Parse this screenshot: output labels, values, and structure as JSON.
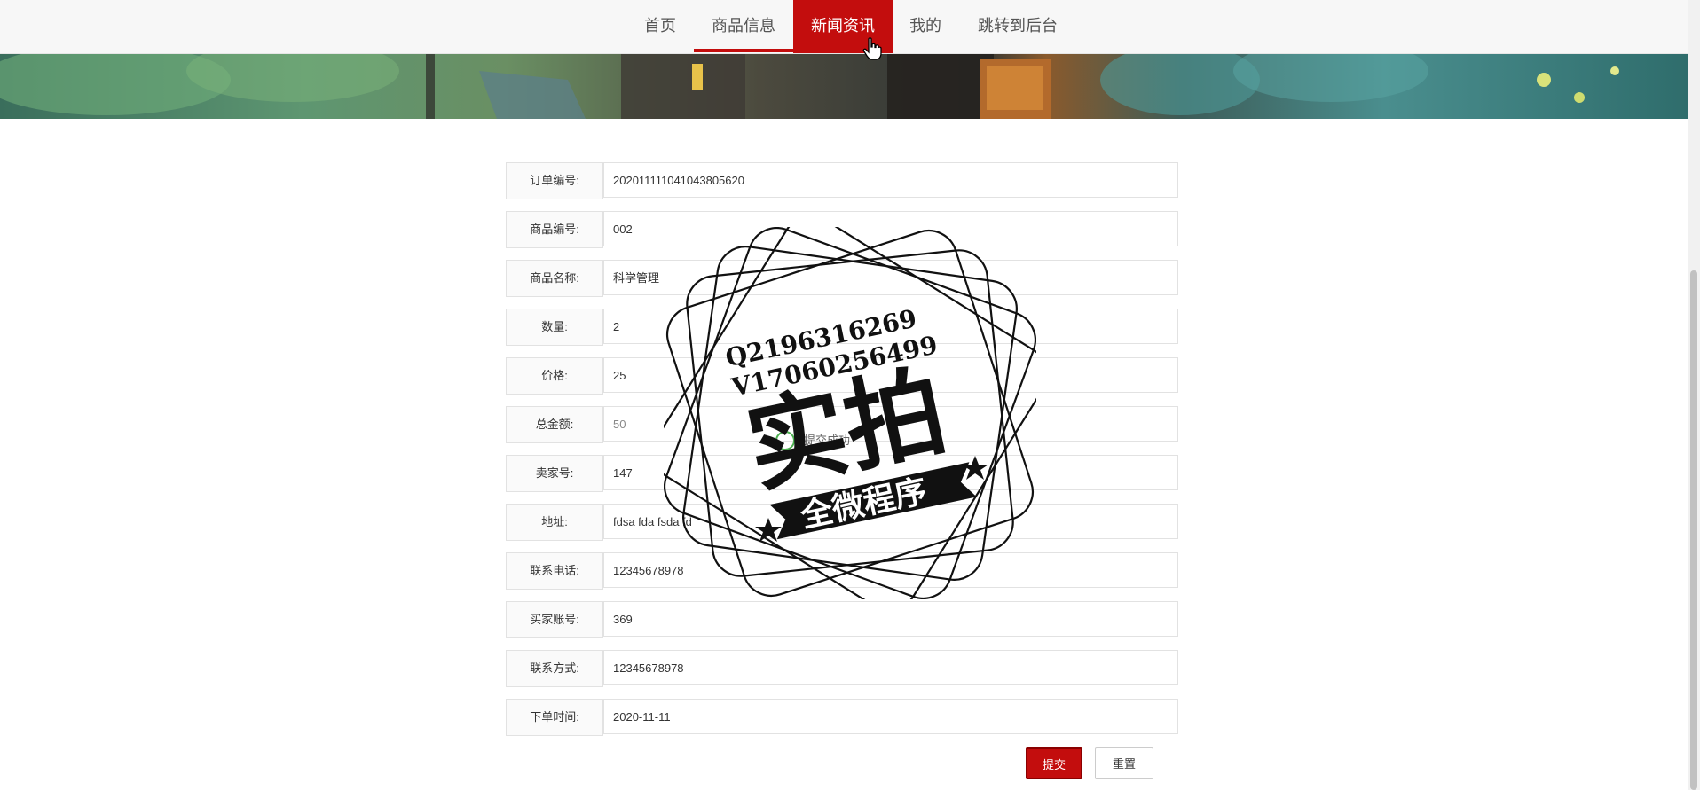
{
  "nav": {
    "items": [
      {
        "label": "首页"
      },
      {
        "label": "商品信息"
      },
      {
        "label": "新闻资讯"
      },
      {
        "label": "我的"
      },
      {
        "label": "跳转到后台"
      }
    ],
    "active": "新闻资讯"
  },
  "order_form": {
    "rows": [
      {
        "label": "订单编号:",
        "value": "202011111041043805620"
      },
      {
        "label": "商品编号:",
        "value": "002"
      },
      {
        "label": "商品名称:",
        "value": "科学管理"
      },
      {
        "label": "数量:",
        "value": "2"
      },
      {
        "label": "价格:",
        "value": "25"
      },
      {
        "label": "总金额:",
        "value": "50"
      },
      {
        "label": "卖家号:",
        "value": "147"
      },
      {
        "label": "地址:",
        "value": "fdsa fda fsda fd"
      },
      {
        "label": "联系电话:",
        "value": "12345678978"
      },
      {
        "label": "买家账号:",
        "value": "369"
      },
      {
        "label": "联系方式:",
        "value": "12345678978"
      },
      {
        "label": "下单时间:",
        "value": "2020-11-11"
      }
    ],
    "submit_label": "提交",
    "reset_label": "重置"
  },
  "toast": {
    "text": "提交成功"
  },
  "watermark": {
    "line1": "Q2196316269",
    "line2": "V17060256499",
    "main": "实拍",
    "banner": "全微程序"
  },
  "colors": {
    "accent": "#c30d0d",
    "nav_bg": "#f7f7f7",
    "border": "#e2e2e2"
  }
}
